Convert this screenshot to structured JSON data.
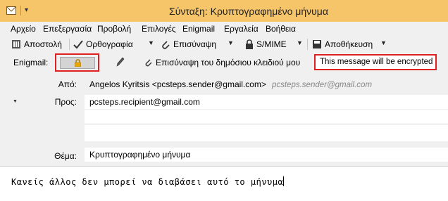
{
  "window": {
    "title": "Σύνταξη: Κρυπτογραφημένο μήνυμα"
  },
  "menu": {
    "file": "Αρχείο",
    "edit": "Επεξεργασία",
    "view": "Προβολή",
    "options": "Επιλογές",
    "enigmail": "Enigmail",
    "tools": "Εργαλεία",
    "help": "Βοήθεια"
  },
  "toolbar": {
    "send": "Αποστολή",
    "spelling": "Ορθογραφία",
    "attach": "Επισύναψη",
    "smime": "S/MIME",
    "save": "Αποθήκευση"
  },
  "enigmail_bar": {
    "label": "Enigmail:",
    "attach_key": "Επισύναψη του δημόσιου κλειδιού μου",
    "status": "This message will be encrypted"
  },
  "headers": {
    "from_label": "Από:",
    "from_value": "Angelos Kyritsis <pcsteps.sender@gmail.com>",
    "from_hint": "pcsteps.sender@gmail.com",
    "to_label": "Προς:",
    "to_value": "pcsteps.recipient@gmail.com",
    "subject_label": "Θέμα:",
    "subject_value": "Κρυπτογραφημένο μήνυμα"
  },
  "body": {
    "text": "Κανείς άλλος δεν μπορεί να διαβάσει αυτό το μήνυμα"
  },
  "colors": {
    "titlebar": "#f6c56a",
    "highlight_border": "#e02020",
    "lock": "#e8a800"
  },
  "icons": [
    "app-icon",
    "send-icon",
    "spellcheck-icon",
    "attach-icon",
    "lock-icon",
    "save-icon",
    "padlock-icon",
    "pencil-icon",
    "paperclip-icon"
  ]
}
